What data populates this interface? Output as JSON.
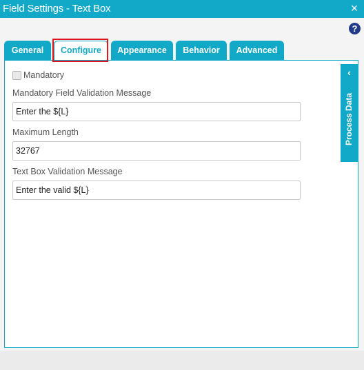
{
  "window": {
    "title": "Field Settings - Text Box",
    "close_icon": "×",
    "help_icon": "?"
  },
  "tabs": [
    {
      "label": "General",
      "active": false
    },
    {
      "label": "Configure",
      "active": true
    },
    {
      "label": "Appearance",
      "active": false
    },
    {
      "label": "Behavior",
      "active": false
    },
    {
      "label": "Advanced",
      "active": false
    }
  ],
  "colors": {
    "accent": "#12a9c8",
    "highlight": "#e0141e",
    "help": "#213a8a"
  },
  "configure": {
    "mandatory": {
      "label": "Mandatory",
      "checked": false
    },
    "mandatory_message": {
      "label": "Mandatory Field Validation Message",
      "value": "Enter the ${L}"
    },
    "max_length": {
      "label": "Maximum Length",
      "value": "32767"
    },
    "validation_message": {
      "label": "Text Box Validation Message",
      "value": "Enter the valid ${L}"
    }
  },
  "process_data": {
    "label": "Process Data",
    "chevron": "‹"
  }
}
